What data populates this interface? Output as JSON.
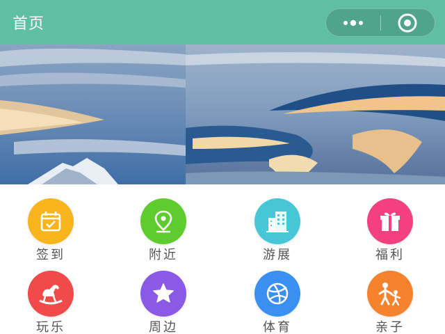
{
  "nav": {
    "title": "首页",
    "more_icon": "more-dots-icon",
    "close_icon": "target-circle-icon"
  },
  "banner": {
    "slides": [
      "lenticular-clouds-mountain",
      "lenticular-clouds-sunset"
    ],
    "active_index": 2,
    "dot_count": 3
  },
  "grid": {
    "items": [
      {
        "label": "签到",
        "icon": "calendar-check-icon",
        "color": "#f7b51d"
      },
      {
        "label": "附近",
        "icon": "location-pin-icon",
        "color": "#5ecb2f"
      },
      {
        "label": "游展",
        "icon": "buildings-icon",
        "color": "#47c6d8"
      },
      {
        "label": "福利",
        "icon": "gift-icon",
        "color": "#f2417e"
      },
      {
        "label": "玩乐",
        "icon": "rocking-horse-icon",
        "color": "#f04a4a"
      },
      {
        "label": "周边",
        "icon": "star-icon",
        "color": "#8a59e6"
      },
      {
        "label": "体育",
        "icon": "ball-icon",
        "color": "#3a8ff2"
      },
      {
        "label": "亲子",
        "icon": "parent-child-icon",
        "color": "#f7822d"
      }
    ]
  },
  "colors": {
    "navbar": "#5ebfa3",
    "label_text": "#555555"
  }
}
